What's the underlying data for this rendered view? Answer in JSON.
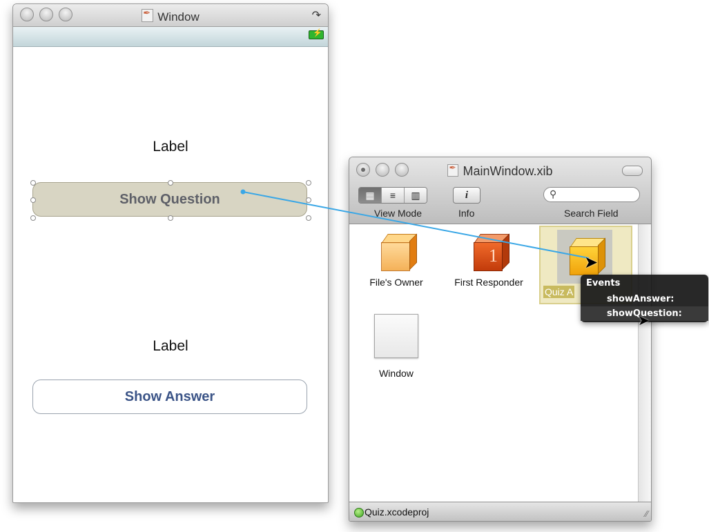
{
  "ib_window": {
    "title": "Window",
    "labels": [
      "Label",
      "Label"
    ],
    "show_question": "Show Question",
    "show_answer": "Show Answer"
  },
  "xib_window": {
    "title": "MainWindow.xib",
    "toolbar": {
      "view_mode_label": "View Mode",
      "info_label": "Info",
      "info_glyph": "i",
      "search_label": "Search Field",
      "search_value": ""
    },
    "objects": {
      "files_owner": "File's Owner",
      "first_responder": "First Responder",
      "quiz_app_delegate": "Quiz A",
      "window": "Window"
    },
    "status": "Quiz.xcodeproj"
  },
  "connection_popup": {
    "header": "Events",
    "actions": [
      "showAnswer:",
      "showQuestion:"
    ],
    "highlighted": "showQuestion:"
  },
  "colors": {
    "connection_line": "#3aa7e6",
    "selection_fill": "#efe9c2",
    "button_question_fill": "#d8d5c3",
    "button_answer_text": "#3b5487"
  },
  "icons": [
    "collapse-icon",
    "battery-icon",
    "doc-icon",
    "icon-view-icon",
    "list-view-icon",
    "column-view-icon",
    "info-icon",
    "search-icon",
    "resize-grip-icon",
    "pointer-cursor-icon"
  ]
}
